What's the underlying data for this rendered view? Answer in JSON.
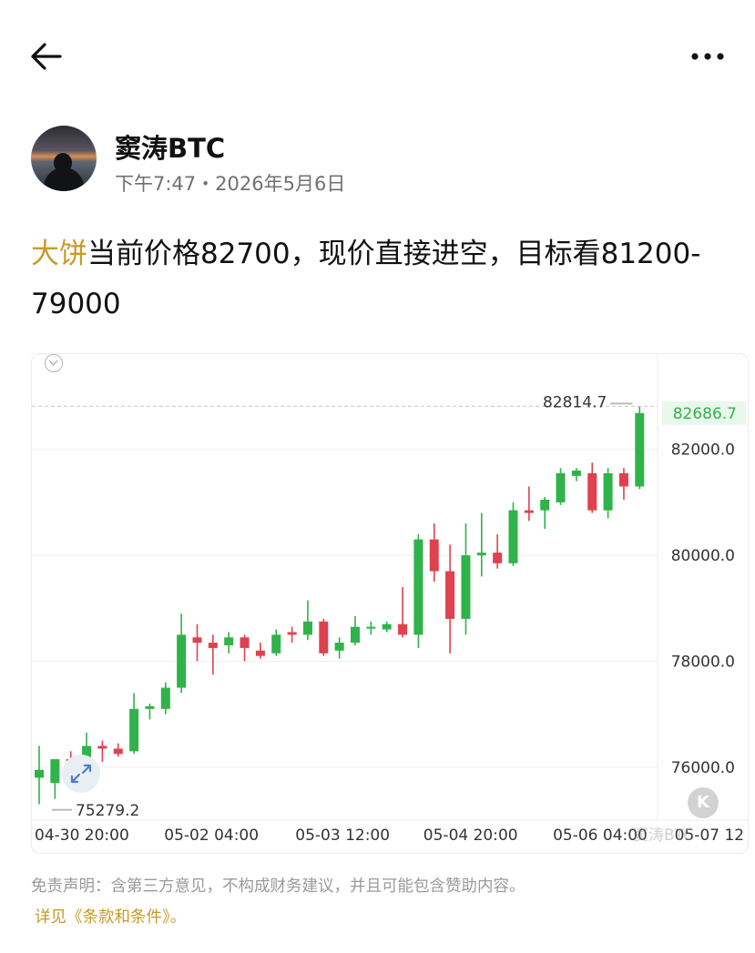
{
  "icons": {
    "back": "arrow-left-icon",
    "more": "more-horizontal-icon",
    "collapse": "chevron-down-icon",
    "expand": "expand-arrows-icon",
    "k_logo": "k-logo-icon"
  },
  "colors": {
    "up": "#2fb34a",
    "down": "#e0414f",
    "accent": "#c89a26",
    "last_price_bg": "#eaf7ec"
  },
  "author": {
    "name": "窦涛BTC",
    "meta": "下午7:47・2026年5月6日"
  },
  "post": {
    "tag": "大饼",
    "text": "当前价格82700，现价直接进空，目标看81200-79000"
  },
  "chart": {
    "k_label": "K",
    "watermark": "窦涛BTC",
    "high_label": "82814.7",
    "low_label": "75279.2",
    "last_price_label": "82686.7"
  },
  "chart_data": {
    "type": "candlestick",
    "interval": "4h",
    "y_ticks": [
      "82000.0",
      "80000.0",
      "78000.0",
      "76000.0"
    ],
    "x_ticks": [
      "04-30 20:00",
      "05-02 04:00",
      "05-03 12:00",
      "05-04 20:00",
      "05-06 04:00",
      "05-07 12"
    ],
    "ylim": [
      75000,
      83800
    ],
    "high": 82814.7,
    "low": 75279.2,
    "last_price": 82686.7,
    "candles": [
      {
        "o": 75800,
        "h": 76400,
        "l": 75300,
        "c": 75950
      },
      {
        "o": 75700,
        "h": 76100,
        "l": 75400,
        "c": 76150
      },
      {
        "o": 76150,
        "h": 76300,
        "l": 75900,
        "c": 76050
      },
      {
        "o": 75950,
        "h": 76650,
        "l": 75900,
        "c": 76400
      },
      {
        "o": 76400,
        "h": 76500,
        "l": 76100,
        "c": 76350
      },
      {
        "o": 76350,
        "h": 76450,
        "l": 76200,
        "c": 76250
      },
      {
        "o": 76300,
        "h": 77400,
        "l": 76250,
        "c": 77100
      },
      {
        "o": 77100,
        "h": 77200,
        "l": 76900,
        "c": 77150
      },
      {
        "o": 77100,
        "h": 77600,
        "l": 77000,
        "c": 77500
      },
      {
        "o": 77500,
        "h": 78900,
        "l": 77400,
        "c": 78500
      },
      {
        "o": 78450,
        "h": 78700,
        "l": 78000,
        "c": 78350
      },
      {
        "o": 78350,
        "h": 78500,
        "l": 77750,
        "c": 78250
      },
      {
        "o": 78300,
        "h": 78550,
        "l": 78150,
        "c": 78450
      },
      {
        "o": 78450,
        "h": 78500,
        "l": 78000,
        "c": 78250
      },
      {
        "o": 78200,
        "h": 78350,
        "l": 78050,
        "c": 78100
      },
      {
        "o": 78150,
        "h": 78600,
        "l": 78100,
        "c": 78500
      },
      {
        "o": 78550,
        "h": 78650,
        "l": 78350,
        "c": 78500
      },
      {
        "o": 78500,
        "h": 79150,
        "l": 78400,
        "c": 78750
      },
      {
        "o": 78750,
        "h": 78800,
        "l": 78100,
        "c": 78150
      },
      {
        "o": 78200,
        "h": 78450,
        "l": 78050,
        "c": 78350
      },
      {
        "o": 78350,
        "h": 78850,
        "l": 78300,
        "c": 78650
      },
      {
        "o": 78650,
        "h": 78750,
        "l": 78500,
        "c": 78650
      },
      {
        "o": 78600,
        "h": 78750,
        "l": 78550,
        "c": 78700
      },
      {
        "o": 78700,
        "h": 79400,
        "l": 78450,
        "c": 78500
      },
      {
        "o": 78500,
        "h": 80400,
        "l": 78250,
        "c": 80300
      },
      {
        "o": 80300,
        "h": 80600,
        "l": 79500,
        "c": 79700
      },
      {
        "o": 79700,
        "h": 80200,
        "l": 78150,
        "c": 78800
      },
      {
        "o": 78800,
        "h": 80600,
        "l": 78500,
        "c": 80000
      },
      {
        "o": 80000,
        "h": 80800,
        "l": 79600,
        "c": 80050
      },
      {
        "o": 80050,
        "h": 80400,
        "l": 79750,
        "c": 79850
      },
      {
        "o": 79850,
        "h": 81000,
        "l": 79800,
        "c": 80850
      },
      {
        "o": 80850,
        "h": 81300,
        "l": 80650,
        "c": 80800
      },
      {
        "o": 80850,
        "h": 81100,
        "l": 80500,
        "c": 81050
      },
      {
        "o": 81000,
        "h": 81650,
        "l": 80950,
        "c": 81550
      },
      {
        "o": 81500,
        "h": 81650,
        "l": 81400,
        "c": 81600
      },
      {
        "o": 81550,
        "h": 81750,
        "l": 80800,
        "c": 80850
      },
      {
        "o": 80850,
        "h": 81650,
        "l": 80700,
        "c": 81550
      },
      {
        "o": 81550,
        "h": 81650,
        "l": 81050,
        "c": 81300
      },
      {
        "o": 81300,
        "h": 82814.7,
        "l": 81250,
        "c": 82686.7
      }
    ]
  },
  "disclaimer": "免责声明：含第三方意见，不构成财务建议，并且可能包含赞助内容。",
  "terms": "详见《条款和条件》。"
}
